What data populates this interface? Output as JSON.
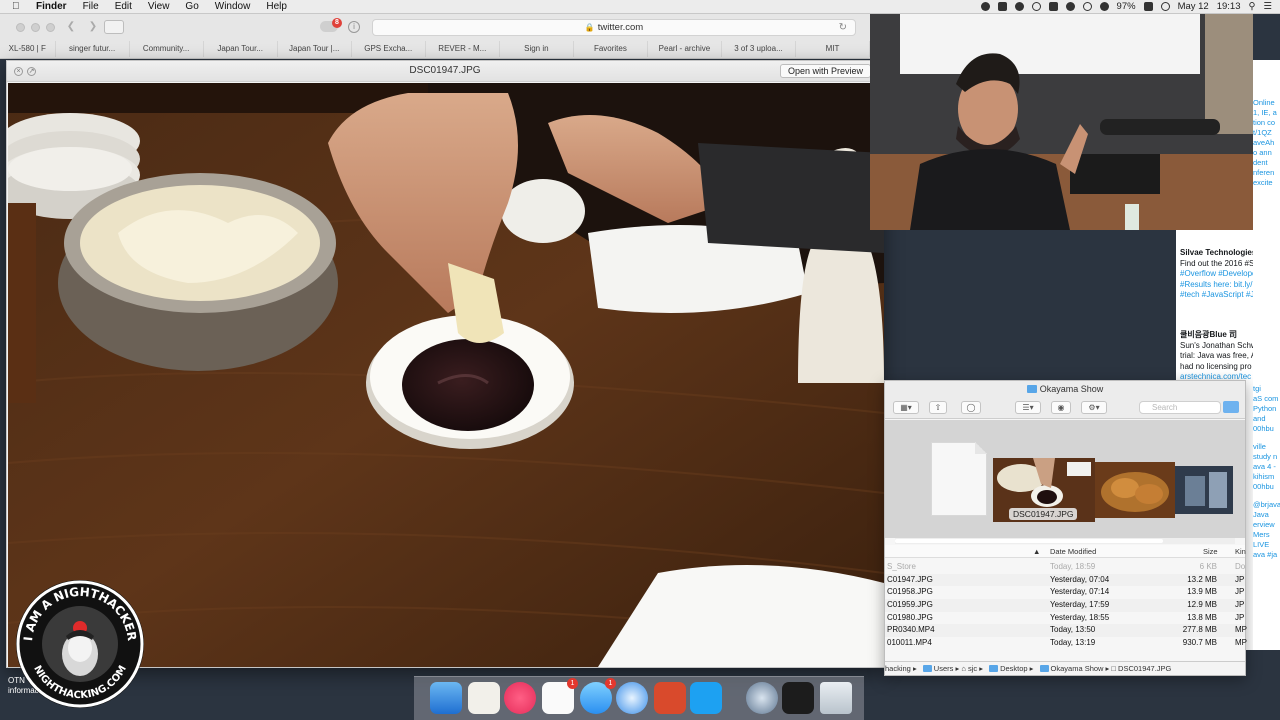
{
  "menubar": {
    "app_name": "Finder",
    "menus": [
      "File",
      "Edit",
      "View",
      "Go",
      "Window",
      "Help"
    ],
    "battery": "97%",
    "date": "May 12",
    "time": "19:13"
  },
  "browser": {
    "url": "twitter.com",
    "extension_badge": "8",
    "bookmarks": [
      "XL-580 | F",
      "singer futur...",
      "Community...",
      "Japan Tour...",
      "Japan Tour |...",
      "GPS Excha...",
      "REVER - M...",
      "Sign in",
      "Favorites",
      "Pearl - archive",
      "3 of 3 uploa...",
      "MIT"
    ]
  },
  "quicklook": {
    "title": "DSC01947.JPG",
    "open_button": "Open with Preview"
  },
  "twitter": {
    "tweets": [
      {
        "author": "Silvae Technologies",
        "text": "Find out the 2016 #S",
        "line2": "#Overflow #Develope",
        "line3": "#Results here: bit.ly/",
        "line4": "#tech #JavaScript #J"
      },
      {
        "author": "쿨비음광Blue 司",
        "text": "Sun's Jonathan Schw",
        "line2": "trial: Java was free, A",
        "line3": "had no licensing pro",
        "line4": "arstechnica.com/tec"
      }
    ],
    "edge_lines": [
      "Online",
      "1, IE, a",
      "tion co",
      "t/1QZ",
      "aveAh",
      "o ann",
      "dent",
      "nferen",
      "excite",
      "tgi",
      "aS com",
      "Python",
      "and",
      "00hbu",
      "ville",
      "study n",
      "ava 4 -",
      "kihism",
      "00hbu",
      "@brjava",
      "Java",
      "erview",
      "Mers LIVE",
      "ava #ja"
    ]
  },
  "finder": {
    "folder_title": "Okayama Show",
    "search_placeholder": "Search",
    "coverflow_caption": "DSC01947.JPG",
    "columns": {
      "date": "Date Modified",
      "size": "Size",
      "kind": "Kin"
    },
    "files": [
      {
        "name": "S_Store",
        "date": "Today, 18:59",
        "size": "6 KB",
        "kind": "Do",
        "dim": true
      },
      {
        "name": "C01947.JPG",
        "date": "Yesterday, 07:04",
        "size": "13.2 MB",
        "kind": "JP",
        "selected": true
      },
      {
        "name": "C01958.JPG",
        "date": "Yesterday, 07:14",
        "size": "13.9 MB",
        "kind": "JP"
      },
      {
        "name": "C01959.JPG",
        "date": "Yesterday, 17:59",
        "size": "12.9 MB",
        "kind": "JP"
      },
      {
        "name": "C01980.JPG",
        "date": "Yesterday, 18:55",
        "size": "13.8 MB",
        "kind": "JP"
      },
      {
        "name": "PR0340.MP4",
        "date": "Today, 13:50",
        "size": "277.8 MB",
        "kind": "MP"
      },
      {
        "name": "010011.MP4",
        "date": "Today, 13:19",
        "size": "930.7 MB",
        "kind": "MP"
      }
    ],
    "path": [
      "hacking",
      "Users",
      "sjc",
      "Desktop",
      "Okayama Show",
      "DSC01947.JPG"
    ]
  },
  "desktop": {
    "labels": [
      "OTN",
      "information"
    ],
    "logo_text_top": "I AM A NIGHTHACKER",
    "logo_text_bottom": "NIGHTHACKING.COM"
  },
  "dock": {
    "calendar_badge": "1",
    "messages_badge": "1"
  },
  "colors": {
    "finder_folder": "#58a6e8",
    "twitter_link": "#1b95e0",
    "badge_red": "#e3382e"
  }
}
